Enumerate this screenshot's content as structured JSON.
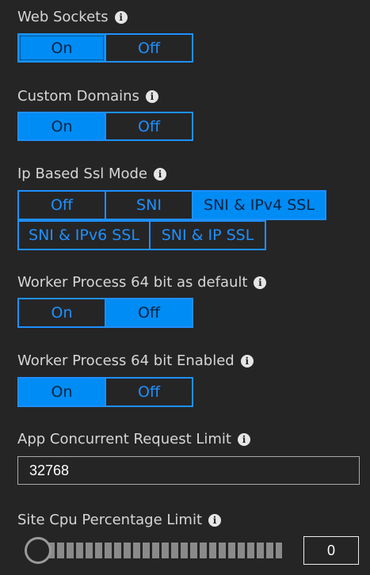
{
  "web_sockets": {
    "label": "Web Sockets",
    "options": [
      "On",
      "Off"
    ],
    "selected": "On"
  },
  "custom_domains": {
    "label": "Custom Domains",
    "options": [
      "On",
      "Off"
    ],
    "selected": "On"
  },
  "ip_based_ssl": {
    "label": "Ip Based Ssl Mode",
    "options": [
      "Off",
      "SNI",
      "SNI & IPv4 SSL",
      "SNI & IPv6 SSL",
      "SNI & IP SSL"
    ],
    "selected": "SNI & IPv4 SSL"
  },
  "worker_64_default": {
    "label": "Worker Process 64 bit as default",
    "options": [
      "On",
      "Off"
    ],
    "selected": "Off"
  },
  "worker_64_enabled": {
    "label": "Worker Process 64 bit Enabled",
    "options": [
      "On",
      "Off"
    ],
    "selected": "On"
  },
  "app_concurrent": {
    "label": "App Concurrent Request Limit",
    "value": "32768"
  },
  "site_cpu": {
    "label": "Site Cpu Percentage Limit",
    "value": "0",
    "slider_fraction": 0
  },
  "colors": {
    "accent": "#1e90ff",
    "selected_fill": "#008cf5",
    "background": "#252526"
  },
  "icons": {
    "info": "info-circle-icon"
  }
}
